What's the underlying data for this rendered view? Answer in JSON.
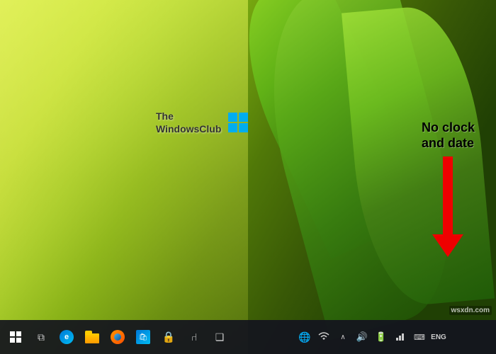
{
  "desktop": {
    "logo": {
      "line1": "The",
      "line2": "WindowsClub"
    },
    "annotation": {
      "line1": "No clock",
      "line2": "and date"
    },
    "watermark": "wsxdn.com"
  },
  "taskbar": {
    "left_icons": [
      {
        "name": "start",
        "symbol": "⊞"
      },
      {
        "name": "task-view",
        "symbol": "⧉"
      },
      {
        "name": "edge",
        "symbol": "e"
      },
      {
        "name": "file-explorer",
        "symbol": "📁"
      },
      {
        "name": "firefox",
        "symbol": "🦊"
      },
      {
        "name": "store",
        "symbol": "🛍"
      },
      {
        "name": "lock",
        "symbol": "🔒"
      },
      {
        "name": "bluetooth",
        "symbol": "⑁"
      },
      {
        "name": "unknown",
        "symbol": "❑"
      }
    ],
    "tray_icons": [
      {
        "name": "globe",
        "symbol": "🌐"
      },
      {
        "name": "wifi",
        "symbol": "📶"
      },
      {
        "name": "chevron",
        "symbol": "∧"
      },
      {
        "name": "volume",
        "symbol": "🔊"
      },
      {
        "name": "battery",
        "symbol": "🔋"
      },
      {
        "name": "network",
        "symbol": "🖧"
      },
      {
        "name": "keyboard",
        "symbol": "⌨"
      },
      {
        "name": "lang",
        "symbol": "ENG"
      }
    ],
    "no_clock_label": ""
  }
}
